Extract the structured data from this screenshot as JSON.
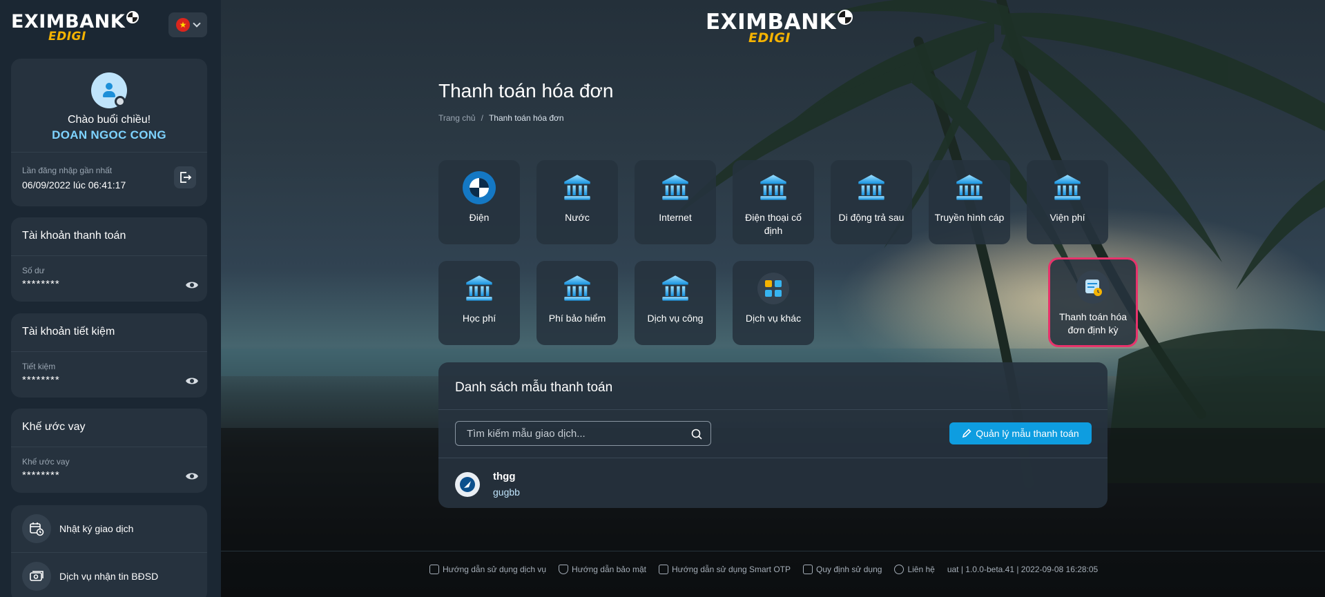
{
  "brand": {
    "name": "EXIMBANK",
    "sub": "EDIGI"
  },
  "sidebar": {
    "greeting": "Chào buổi chiều!",
    "username": "DOAN NGOC CONG",
    "last_login_label": "Lần đăng nhập gần nhất",
    "last_login_value": "06/09/2022 lúc 06:41:17",
    "accounts": [
      {
        "title": "Tài khoản thanh toán",
        "sub": "Số dư",
        "masked": "********"
      },
      {
        "title": "Tài khoản tiết kiệm",
        "sub": "Tiết kiệm",
        "masked": "********"
      },
      {
        "title": "Khế ước vay",
        "sub": "Khế ước vay",
        "masked": "********"
      }
    ],
    "menu": [
      {
        "label": "Nhật ký giao dịch",
        "icon": "calendar-clock-icon"
      },
      {
        "label": "Dịch vụ nhận tin BĐSD",
        "icon": "money-icon"
      }
    ]
  },
  "page": {
    "title": "Thanh toán hóa đơn",
    "breadcrumb": {
      "home": "Trang chủ",
      "separator": "/",
      "current": "Thanh toán hóa đơn"
    }
  },
  "services": [
    {
      "label": "Điện",
      "icon": "eximbank-logo-icon"
    },
    {
      "label": "Nước",
      "icon": "bank-icon"
    },
    {
      "label": "Internet",
      "icon": "bank-icon"
    },
    {
      "label": "Điện thoại cố định",
      "icon": "bank-icon"
    },
    {
      "label": "Di động trả sau",
      "icon": "bank-icon"
    },
    {
      "label": "Truyền hình cáp",
      "icon": "bank-icon"
    },
    {
      "label": "Viện phí",
      "icon": "bank-icon"
    },
    {
      "label": "Học phí",
      "icon": "bank-icon"
    },
    {
      "label": "Phí bảo hiểm",
      "icon": "bank-icon"
    },
    {
      "label": "Dịch vụ công",
      "icon": "bank-icon"
    },
    {
      "label": "Dịch vụ khác",
      "icon": "apps-grid-icon"
    },
    {
      "label": "Thanh toán hóa đơn định kỳ",
      "icon": "scheduled-bill-icon"
    }
  ],
  "templates": {
    "title": "Danh sách mẫu thanh toán",
    "search_placeholder": "Tìm kiếm mẫu giao dịch...",
    "manage_label": "Quản lý mẫu thanh toán",
    "items": [
      {
        "name": "thgg",
        "sub": "gugbb"
      }
    ]
  },
  "footer": {
    "links": [
      "Hướng dẫn sử dụng dịch vụ",
      "Hướng dẫn bảo mật",
      "Hướng dẫn sử dụng Smart OTP",
      "Quy định sử dụng",
      "Liên hệ"
    ],
    "version": "uat | 1.0.0-beta.41 | 2022-09-08 16:28:05"
  },
  "colors": {
    "accent": "#0e9de0",
    "highlight": "#e8326b",
    "username": "#7ed3ff",
    "brand_sub": "#f5b301"
  }
}
